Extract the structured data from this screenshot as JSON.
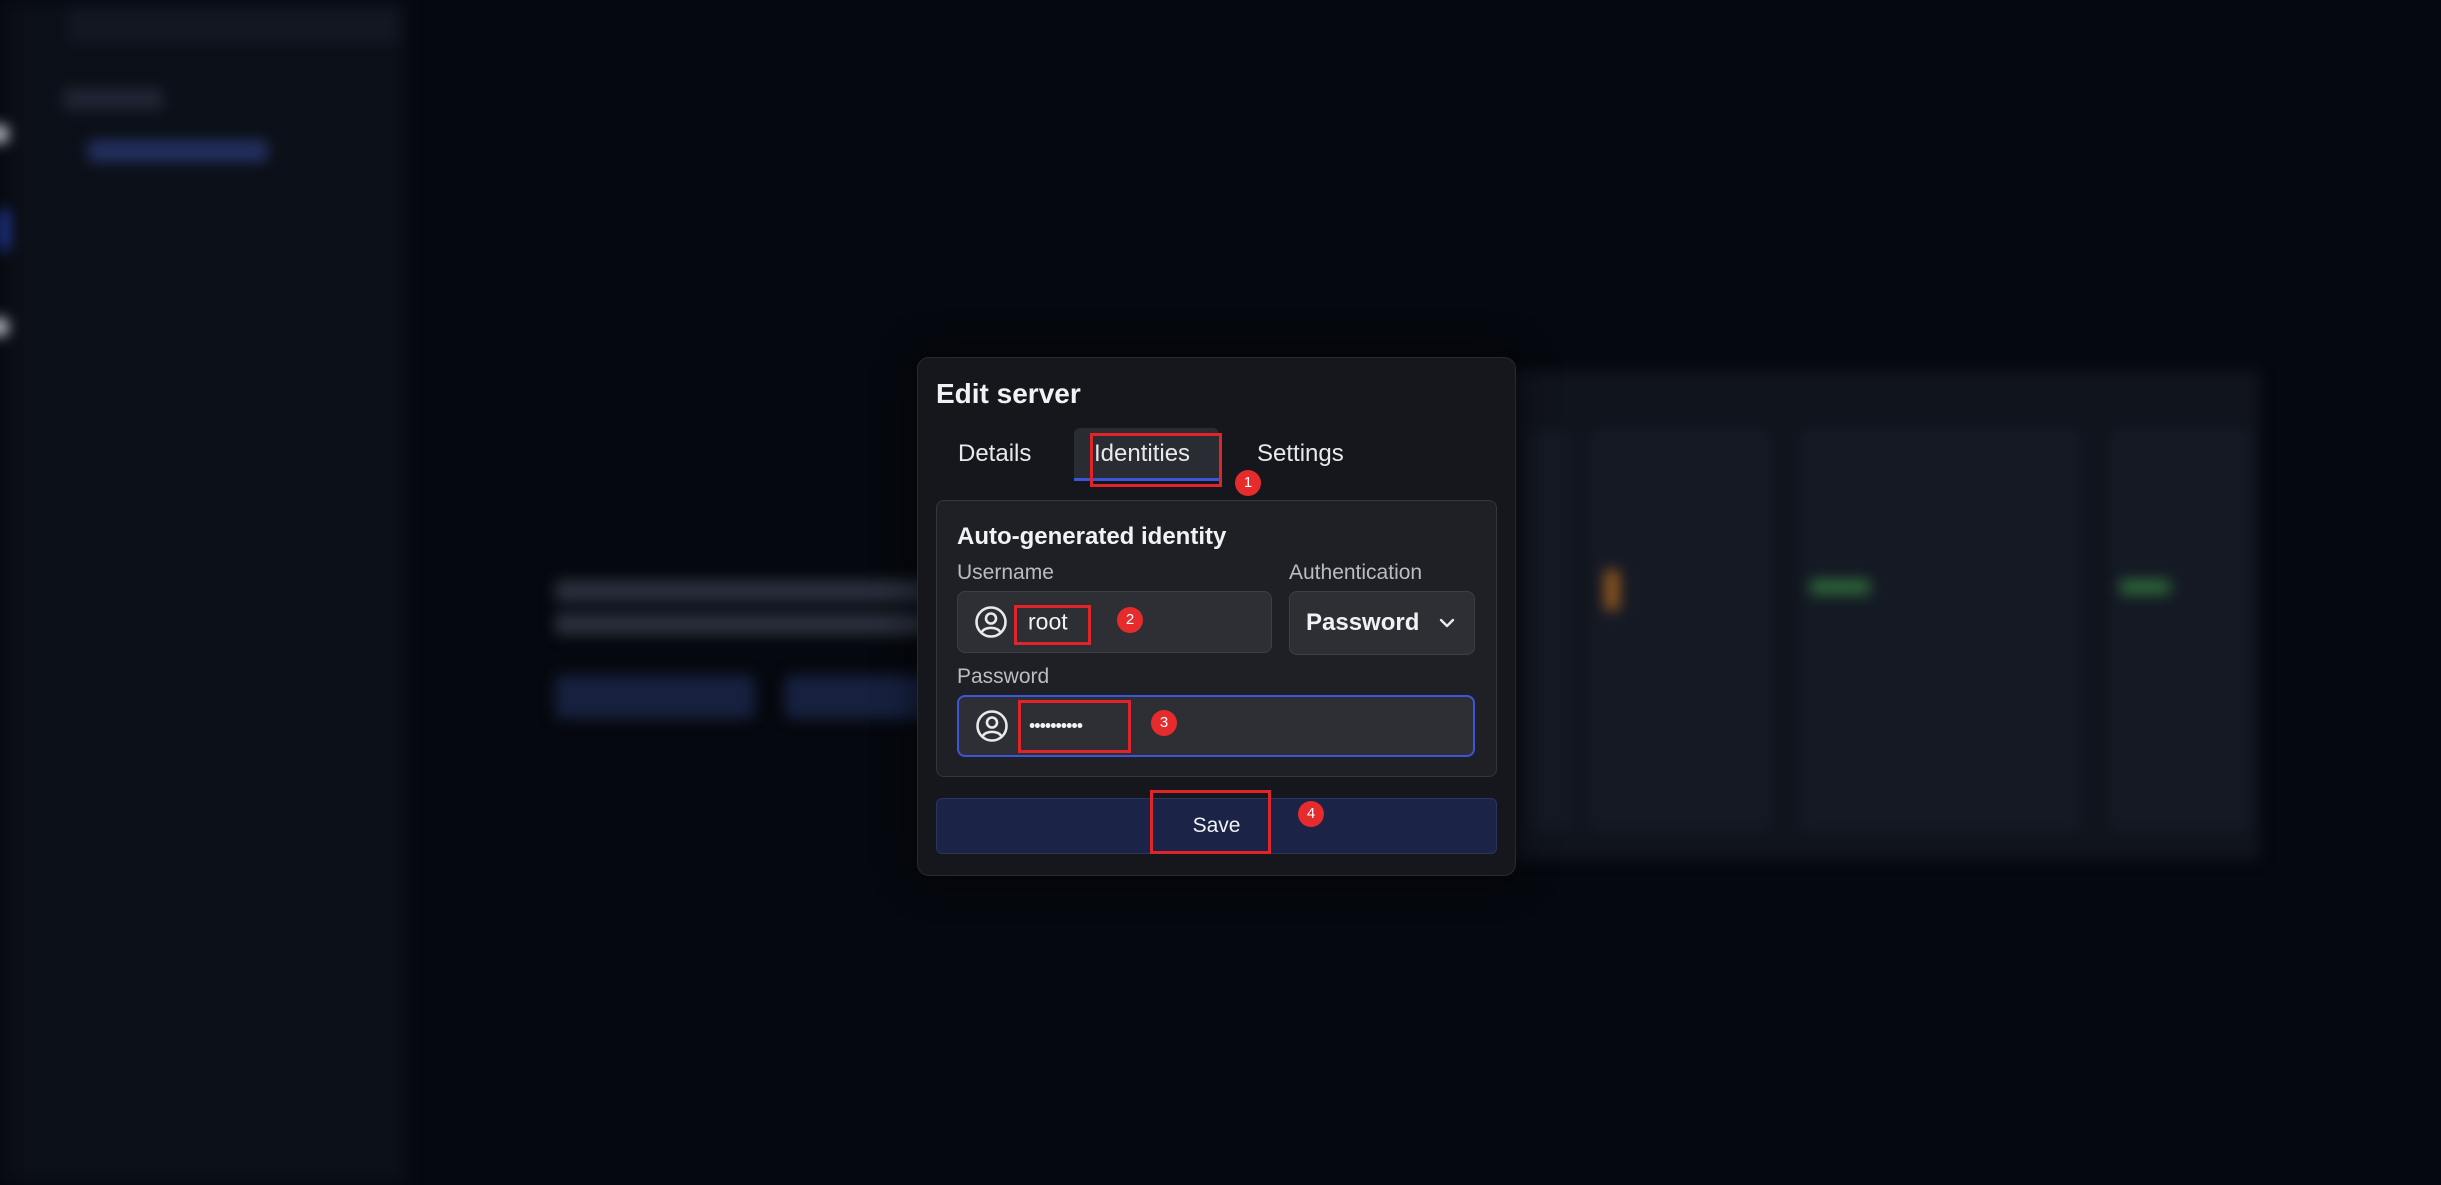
{
  "modal": {
    "title": "Edit server",
    "tabs": [
      {
        "label": "Details",
        "active": false
      },
      {
        "label": "Identities",
        "active": true
      },
      {
        "label": "Settings",
        "active": false
      }
    ],
    "identity": {
      "title": "Auto-generated identity",
      "username_label": "Username",
      "username_value": "root",
      "auth_label": "Authentication",
      "auth_value": "Password",
      "password_label": "Password",
      "password_value": "••••••••••"
    },
    "save_label": "Save"
  },
  "annotations": [
    "1",
    "2",
    "3",
    "4"
  ],
  "colors": {
    "accent": "#3d56d8",
    "annotation": "#e0252a",
    "save_button": "#1b2446"
  },
  "icons": [
    "user-circle-icon",
    "chevron-down-icon"
  ]
}
